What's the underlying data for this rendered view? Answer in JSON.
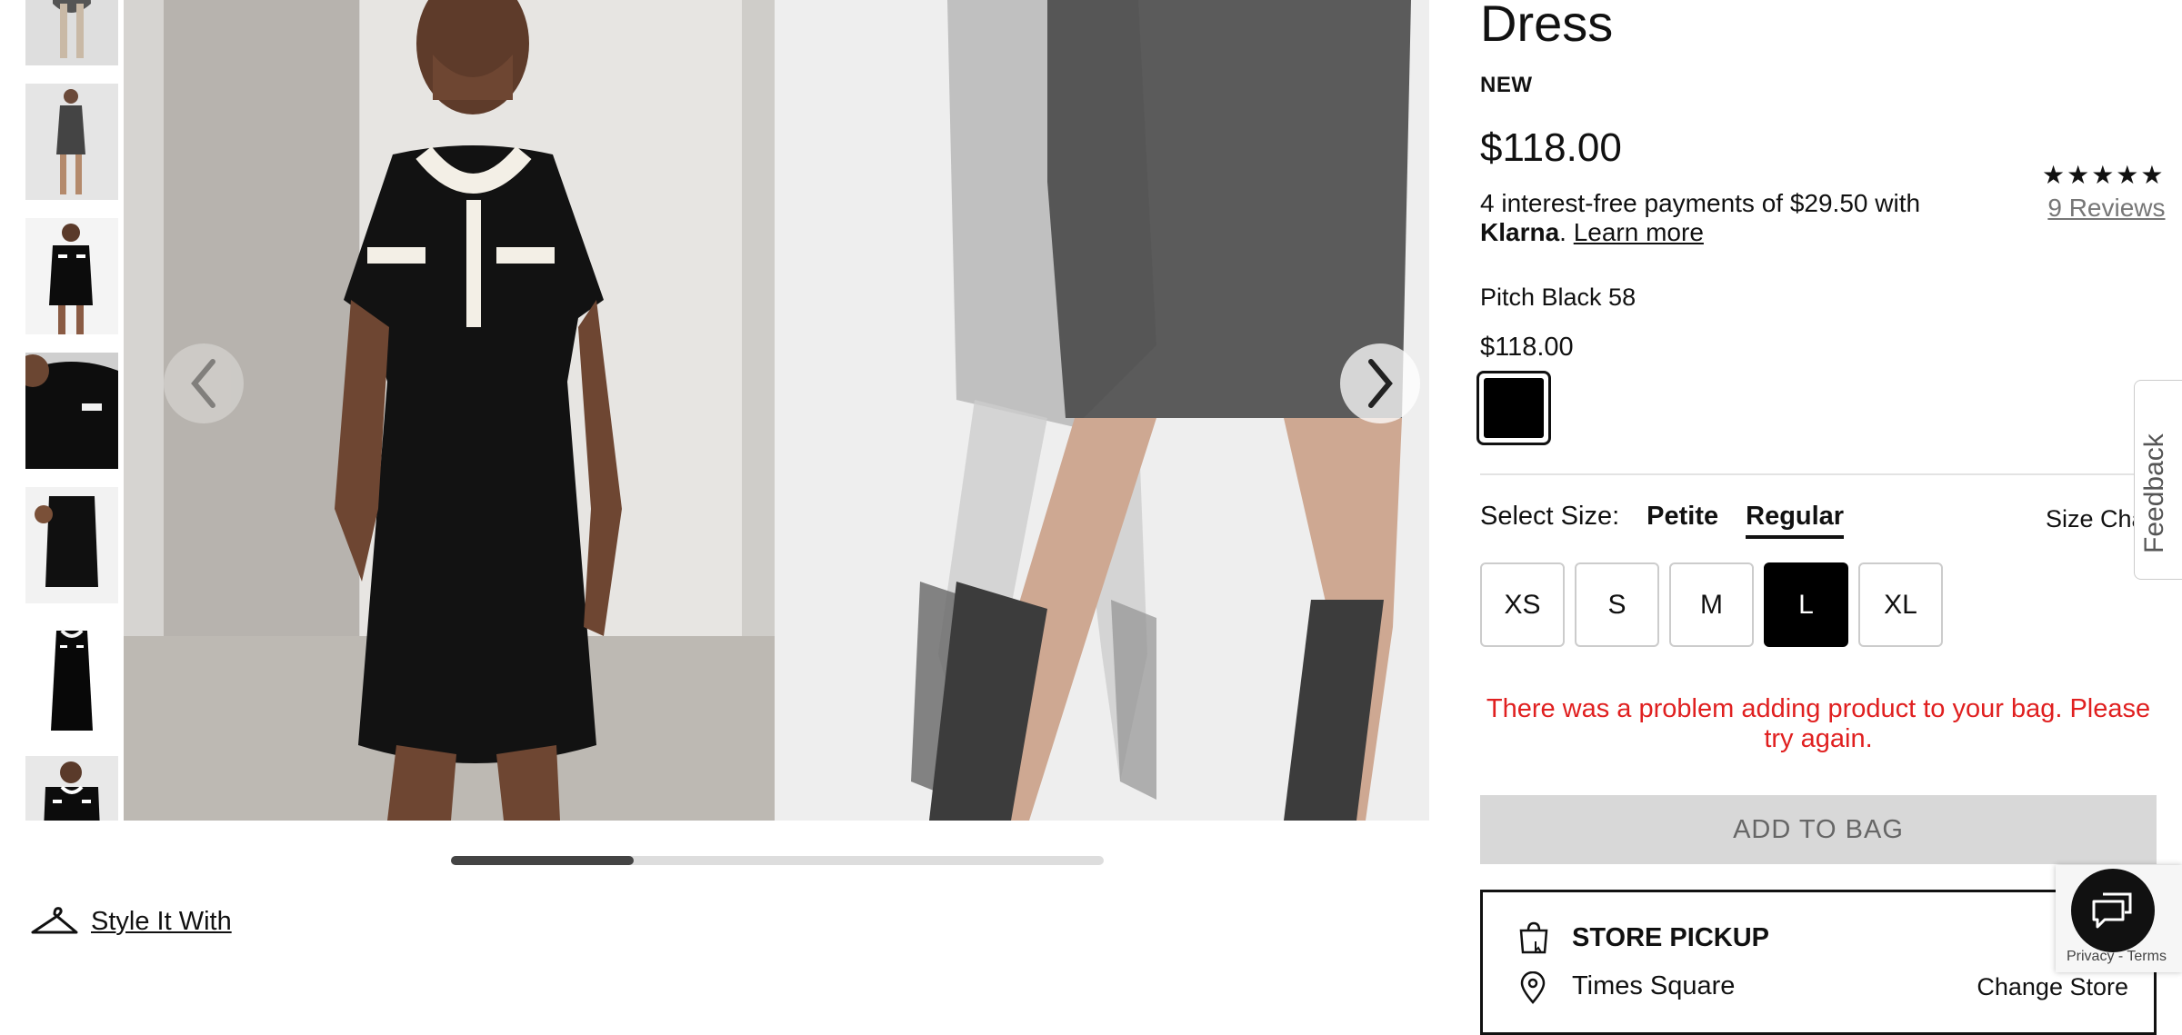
{
  "product": {
    "title": "Dress",
    "badge": "NEW",
    "price": "$118.00",
    "klarna": {
      "text": "4 interest-free payments of $29.50 with",
      "brand": "Klarna",
      "separator": ".",
      "learn_more": "Learn more"
    },
    "rating": {
      "stars": "★★★★★",
      "reviews": "9 Reviews"
    },
    "color_name": "Pitch Black 58",
    "color_price": "$118.00",
    "swatch_color": "#000000",
    "size_label": "Select Size:",
    "size_fits": [
      {
        "label": "Petite",
        "active": false
      },
      {
        "label": "Regular",
        "active": true
      }
    ],
    "size_chart_label": "Size Cha",
    "sizes": [
      "XS",
      "S",
      "M",
      "L",
      "XL"
    ],
    "selected_size": "L",
    "error_message": "There was a problem adding product to your bag. Please try again.",
    "add_to_bag": "ADD TO BAG",
    "store_pickup": {
      "title": "STORE PICKUP",
      "store": "Times Square",
      "change": "Change Store"
    }
  },
  "gallery": {
    "style_it_with": "Style It With",
    "thumbnail_count": 7,
    "progress": 0.28
  },
  "widgets": {
    "feedback": "Feedback",
    "recaptcha_links": "Privacy - Terms"
  },
  "colors": {
    "error": "#e02020",
    "add_to_bag_bg": "#d8d8d8",
    "selected_size_bg": "#000000"
  }
}
